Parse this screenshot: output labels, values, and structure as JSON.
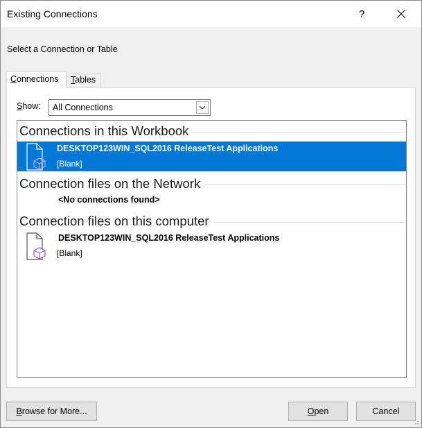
{
  "window": {
    "title": "Existing Connections",
    "help_label": "?"
  },
  "instruction": "Select a Connection or Table",
  "tabs": [
    {
      "label": "Connections",
      "accel": "C",
      "rest": "onnections"
    },
    {
      "label": "Tables",
      "accel": "T",
      "rest": "ables"
    }
  ],
  "show": {
    "label_accel": "S",
    "label_rest": "how:",
    "selected": "All Connections"
  },
  "groups": [
    {
      "title": "Connections in this Workbook"
    },
    {
      "title": "Connection files on the Network",
      "empty_text": "<No connections found>"
    },
    {
      "title": "Connection files on this computer"
    }
  ],
  "items": [
    {
      "name": "DESKTOP123WIN_SQL2016 ReleaseTest Applications",
      "description": "[Blank]",
      "selected": true
    },
    {
      "name": "DESKTOP123WIN_SQL2016 ReleaseTest Applications",
      "description": "[Blank]",
      "selected": false
    }
  ],
  "buttons": {
    "browse_accel": "B",
    "browse_rest": "rowse for More...",
    "open_accel": "O",
    "open_rest": "pen",
    "cancel": "Cancel"
  },
  "colors": {
    "selection": "#0078d7",
    "cube_icon": "#9b59d0"
  },
  "icons": {
    "file_with_cube": "connection-file-icon",
    "close": "close-icon",
    "dropdown": "chevron-down-icon"
  }
}
